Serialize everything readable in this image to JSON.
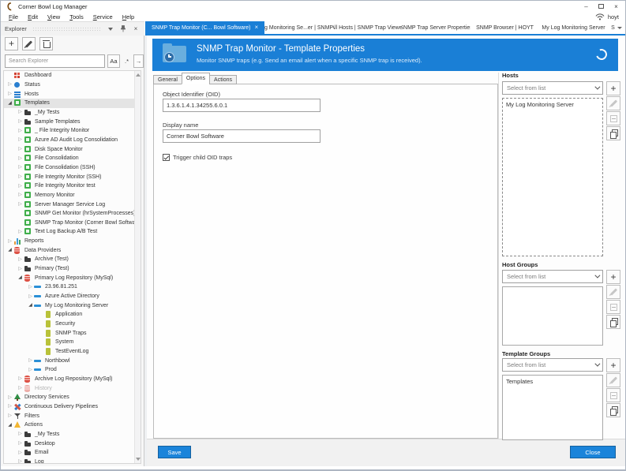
{
  "window": {
    "title": "Corner Bowl Log Manager",
    "user": "hoyt"
  },
  "menu": {
    "items": [
      "File",
      "Edit",
      "View",
      "Tools",
      "Service",
      "Help"
    ]
  },
  "tabs": {
    "items": [
      {
        "label": "SNMP Trap Monitor (C... Bowl Software)",
        "active": true,
        "closable": true
      },
      {
        "label": "My Log Monitoring Se...er | SNMP Traps",
        "active": false,
        "closable": false
      },
      {
        "label": "All Hosts | SNMP Trap Viewer",
        "active": false,
        "closable": false
      },
      {
        "label": "SNMP Trap Server Properties",
        "active": false,
        "closable": false
      },
      {
        "label": "SNMP Browser | HOYT",
        "active": false,
        "closable": false
      },
      {
        "label": "My Log Monitoring Server",
        "active": false,
        "closable": false
      }
    ],
    "overflow_label": "S"
  },
  "explorer": {
    "title": "Explorer",
    "toolbar": [
      "add",
      "edit",
      "delete"
    ],
    "search_placeholder": "Search Explorer",
    "search_buttons": {
      "match_case": "Aa",
      "regex": ".*",
      "go": "→"
    },
    "tree": [
      {
        "label": "Dashboard",
        "depth": 1,
        "icon": "dashboard",
        "expand": "none"
      },
      {
        "label": "Status",
        "depth": 1,
        "icon": "status",
        "expand": "closed"
      },
      {
        "label": "Hosts",
        "depth": 1,
        "icon": "hosts",
        "expand": "closed"
      },
      {
        "label": "Templates",
        "depth": 1,
        "icon": "template",
        "expand": "open",
        "selected": true
      },
      {
        "label": "_My Tests",
        "depth": 2,
        "icon": "folder",
        "expand": "closed"
      },
      {
        "label": "Sample Templates",
        "depth": 2,
        "icon": "folder",
        "expand": "closed"
      },
      {
        "label": "_ File Integrity Monitor",
        "depth": 2,
        "icon": "template",
        "expand": "closed"
      },
      {
        "label": "Azure AD Audit Log Consolidation",
        "depth": 2,
        "icon": "template",
        "expand": "closed"
      },
      {
        "label": "Disk Space Monitor",
        "depth": 2,
        "icon": "template",
        "expand": "closed"
      },
      {
        "label": "File Consolidation",
        "depth": 2,
        "icon": "template",
        "expand": "closed"
      },
      {
        "label": "File Consolidation (SSH)",
        "depth": 2,
        "icon": "template",
        "expand": "closed"
      },
      {
        "label": "File Integrity Monitor (SSH)",
        "depth": 2,
        "icon": "template",
        "expand": "closed"
      },
      {
        "label": "File Integrity Monitor test",
        "depth": 2,
        "icon": "template",
        "expand": "closed"
      },
      {
        "label": "Memory Monitor",
        "depth": 2,
        "icon": "template",
        "expand": "closed"
      },
      {
        "label": "Server Manager Service Log",
        "depth": 2,
        "icon": "template",
        "expand": "closed"
      },
      {
        "label": "SNMP Get Monitor (hrSystemProcesses)",
        "depth": 2,
        "icon": "template",
        "expand": "none"
      },
      {
        "label": "SNMP Trap Monitor (Corner Bowl Software)",
        "depth": 2,
        "icon": "template",
        "expand": "none"
      },
      {
        "label": "Text Log Backup A/B Test",
        "depth": 2,
        "icon": "template",
        "expand": "closed"
      },
      {
        "label": "Reports",
        "depth": 1,
        "icon": "report",
        "expand": "closed"
      },
      {
        "label": "Data Providers",
        "depth": 1,
        "icon": "db",
        "expand": "open"
      },
      {
        "label": "Archive (Test)",
        "depth": 2,
        "icon": "folder",
        "expand": "closed"
      },
      {
        "label": "Primary (Test)",
        "depth": 2,
        "icon": "folder",
        "expand": "closed"
      },
      {
        "label": "Primary Log Repository (MySql)",
        "depth": 2,
        "icon": "db",
        "expand": "open"
      },
      {
        "label": "23.96.81.251",
        "depth": 3,
        "icon": "server",
        "expand": "closed"
      },
      {
        "label": "Azure Active Directory",
        "depth": 3,
        "icon": "server",
        "expand": "closed"
      },
      {
        "label": "My Log Monitoring Server",
        "depth": 3,
        "icon": "server",
        "expand": "open"
      },
      {
        "label": "Application",
        "depth": 4,
        "icon": "logfile",
        "expand": "none"
      },
      {
        "label": "Security",
        "depth": 4,
        "icon": "logfile",
        "expand": "none"
      },
      {
        "label": "SNMP Traps",
        "depth": 4,
        "icon": "logfile",
        "expand": "none"
      },
      {
        "label": "System",
        "depth": 4,
        "icon": "logfile",
        "expand": "none"
      },
      {
        "label": "TestEventLog",
        "depth": 4,
        "icon": "logfile",
        "expand": "none"
      },
      {
        "label": "Northbowl",
        "depth": 3,
        "icon": "server",
        "expand": "closed"
      },
      {
        "label": "Prod",
        "depth": 3,
        "icon": "server",
        "expand": "closed"
      },
      {
        "label": "Archive Log Repository (MySql)",
        "depth": 2,
        "icon": "db",
        "expand": "closed"
      },
      {
        "label": "History",
        "depth": 2,
        "icon": "db",
        "expand": "closed",
        "disabled": true
      },
      {
        "label": "Directory Services",
        "depth": 1,
        "icon": "directory",
        "expand": "closed"
      },
      {
        "label": "Continuous Delivery Pipelines",
        "depth": 1,
        "icon": "pipeline",
        "expand": "closed"
      },
      {
        "label": "Filters",
        "depth": 1,
        "icon": "filter",
        "expand": "closed"
      },
      {
        "label": "Actions",
        "depth": 1,
        "icon": "actions",
        "expand": "open"
      },
      {
        "label": "_My Tests",
        "depth": 2,
        "icon": "folder",
        "expand": "closed"
      },
      {
        "label": "Desktop",
        "depth": 2,
        "icon": "folder",
        "expand": "closed"
      },
      {
        "label": "Email",
        "depth": 2,
        "icon": "folder",
        "expand": "closed"
      },
      {
        "label": "Log",
        "depth": 2,
        "icon": "folder",
        "expand": "closed"
      }
    ]
  },
  "banner": {
    "title": "SNMP Trap Monitor - Template Properties",
    "subtitle": "Monitor SNMP traps (e.g. Send an email alert when a specific SNMP trap is received)."
  },
  "form": {
    "tabs": [
      "General",
      "Options",
      "Actions"
    ],
    "active_tab": "Options",
    "fields": [
      {
        "label": "Object Identifier (OID)",
        "value": "1.3.6.1.4.1.34255.6.0.1"
      },
      {
        "label": "Display name",
        "value": "Corner Bowl Software"
      }
    ],
    "checkbox": {
      "label": "Trigger child OID traps",
      "checked": true
    },
    "save_label": "Save"
  },
  "panels": [
    {
      "title": "Hosts",
      "dropdown": "Select from list",
      "items": [
        "My Log Monitoring Server"
      ]
    },
    {
      "title": "Host Groups",
      "dropdown": "Select from list",
      "items": []
    },
    {
      "title": "Template Groups",
      "dropdown": "Select from list",
      "items": [
        "Templates"
      ]
    }
  ],
  "close_label": "Close",
  "colors": {
    "accent": "#1a7fd6",
    "banner_icon": "#69aede",
    "template_green": "#3fae4a",
    "database_red": "#dd5145"
  }
}
